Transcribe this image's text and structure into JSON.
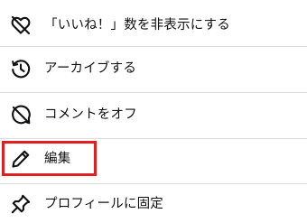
{
  "menu": {
    "items": [
      {
        "label": "「いいね！」数を非表示にする",
        "icon": "heart-off-icon"
      },
      {
        "label": "アーカイブする",
        "icon": "archive-history-icon"
      },
      {
        "label": "コメントをオフ",
        "icon": "comment-off-icon"
      },
      {
        "label": "編集",
        "icon": "pencil-icon"
      },
      {
        "label": "プロフィールに固定",
        "icon": "pin-icon"
      }
    ]
  },
  "highlight": {
    "color": "#e02020",
    "target": "編集"
  }
}
